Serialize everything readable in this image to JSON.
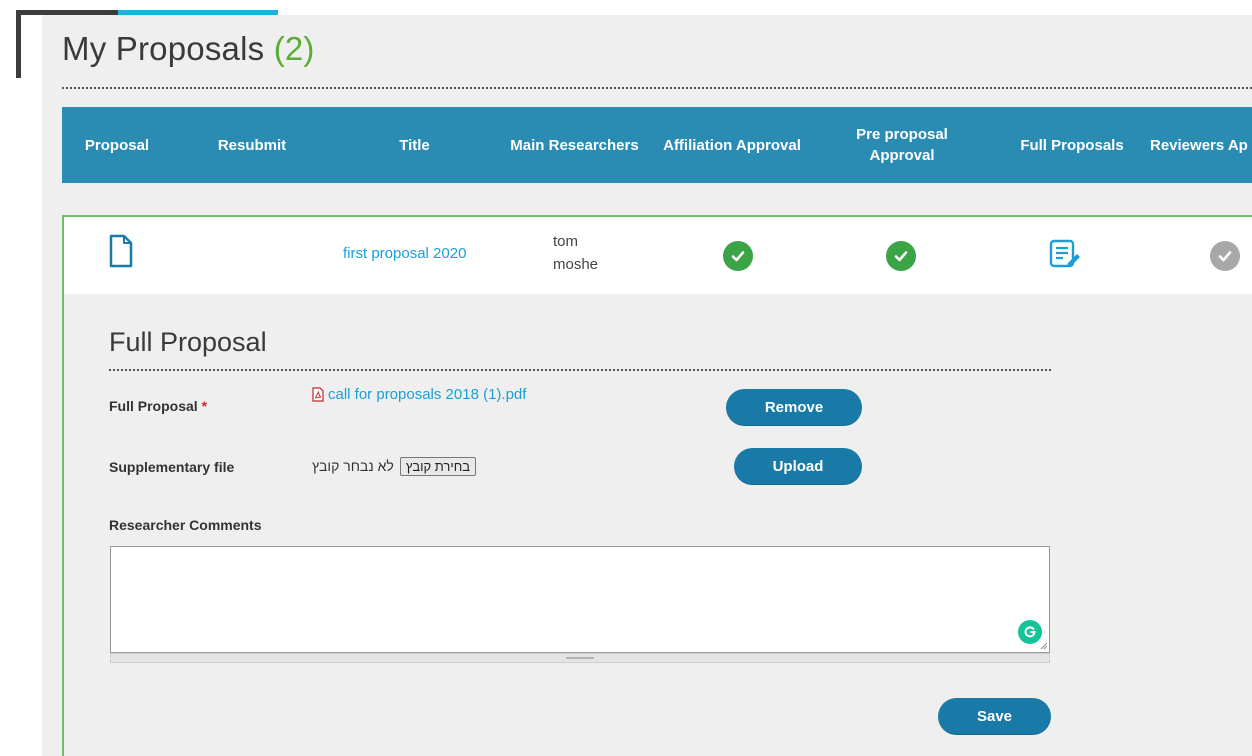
{
  "page": {
    "title": "My Proposals",
    "count": "(2)"
  },
  "table": {
    "headers": [
      "Proposal",
      "Resubmit",
      "Title",
      "Main Researchers",
      "Affiliation Approval",
      "Pre proposal Approval",
      "Full Proposals",
      "Reviewers Ap"
    ],
    "row": {
      "title": "first proposal 2020",
      "researchers": [
        "tom",
        "moshe"
      ],
      "statuses": [
        {
          "column": "Affiliation Approval",
          "state": "approved",
          "icon": "check-circle-icon",
          "color": "#3aa447"
        },
        {
          "column": "Pre proposal Approval",
          "state": "approved",
          "icon": "check-circle-icon",
          "color": "#3aa447"
        },
        {
          "column": "Full Proposals",
          "state": "edit",
          "icon": "edit-document-icon",
          "color": "#1a9fd8"
        },
        {
          "column": "Reviewers Ap",
          "state": "pending",
          "icon": "check-circle-icon",
          "color": "#a8a8a8"
        }
      ]
    }
  },
  "form": {
    "section_title": "Full Proposal",
    "full_proposal_label": "Full Proposal",
    "required_mark": "*",
    "full_proposal_file": "call for proposals 2018 (1).pdf",
    "remove_label": "Remove",
    "supplementary_label": "Supplementary file",
    "choose_file_label": "בחירת קובץ",
    "no_file_text": "לא נבחר קובץ",
    "upload_label": "Upload",
    "comments_label": "Researcher Comments",
    "comments_value": "",
    "save_label": "Save"
  },
  "colors": {
    "header_bg": "#2a8cb2",
    "button_bg": "#1a7aa7",
    "link": "#1a9fd8",
    "count": "#5aad34",
    "row_border": "#6cc06c"
  }
}
